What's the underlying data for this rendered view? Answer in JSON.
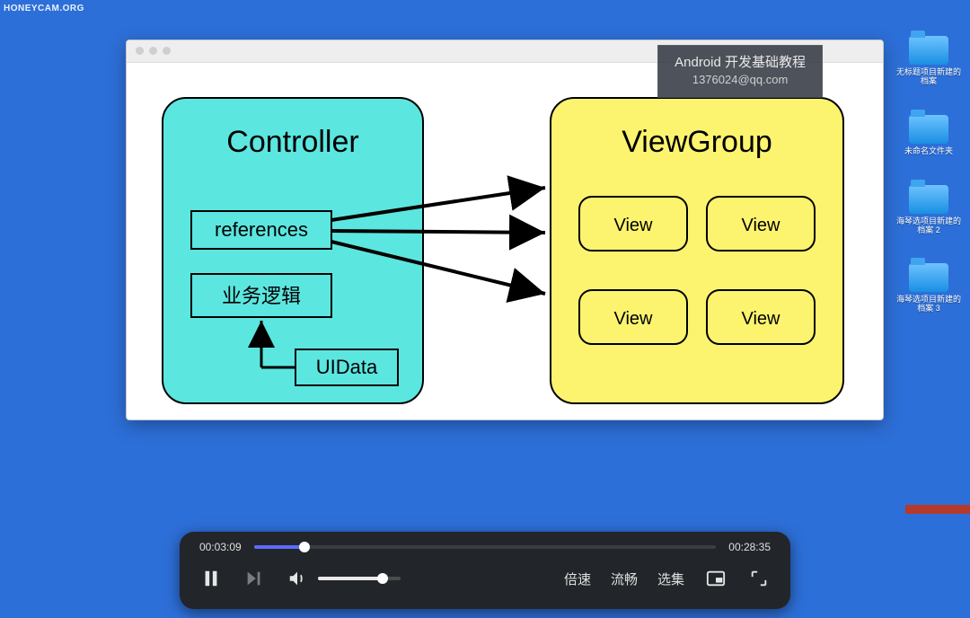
{
  "watermark": "HONEYCAM.ORG",
  "course_overlay": {
    "line1": "Android 开发基础教程",
    "line2": "1376024@qq.com"
  },
  "desktop_icons": [
    {
      "label": "无标题项目新建的\n档案"
    },
    {
      "label": "未命名文件夹"
    },
    {
      "label": "海琴选项目新建的\n档案 2"
    },
    {
      "label": "海琴选项目新建的\n档案 3"
    }
  ],
  "diagram": {
    "controller": {
      "title": "Controller",
      "box_references": "references",
      "box_logic": "业务逻辑",
      "box_uidata": "UIData"
    },
    "viewgroup": {
      "title": "ViewGroup",
      "views": [
        "View",
        "View",
        "View",
        "View"
      ]
    }
  },
  "player": {
    "current_time": "00:03:09",
    "total_time": "00:28:35",
    "progress_pct": 11,
    "volume_pct": 78,
    "labels": {
      "speed": "倍速",
      "quality": "流畅",
      "episodes": "选集"
    }
  }
}
